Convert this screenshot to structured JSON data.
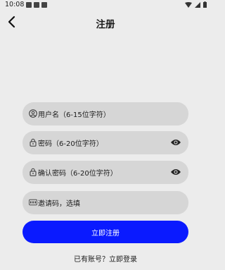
{
  "status_bar": {
    "time": "10:08"
  },
  "header": {
    "title": "注册",
    "back_icon": "chevron-left-icon"
  },
  "form": {
    "username": {
      "placeholder": "用户名（6-15位字符）",
      "icon": "user-icon"
    },
    "password": {
      "placeholder": "密码（6-20位字符）",
      "icon": "lock-icon",
      "toggle_icon": "eye-icon"
    },
    "confirm_password": {
      "placeholder": "确认密码（6-20位字符）",
      "icon": "lock-icon",
      "toggle_icon": "eye-icon"
    },
    "invite_code": {
      "placeholder": "邀请码，选填",
      "icon": "abc-icon"
    }
  },
  "actions": {
    "register_label": "立即注册",
    "login_link": "已有账号？立即登录"
  },
  "colors": {
    "accent": "#0a1aff",
    "background": "#ececec",
    "field": "#d6d6d6"
  }
}
